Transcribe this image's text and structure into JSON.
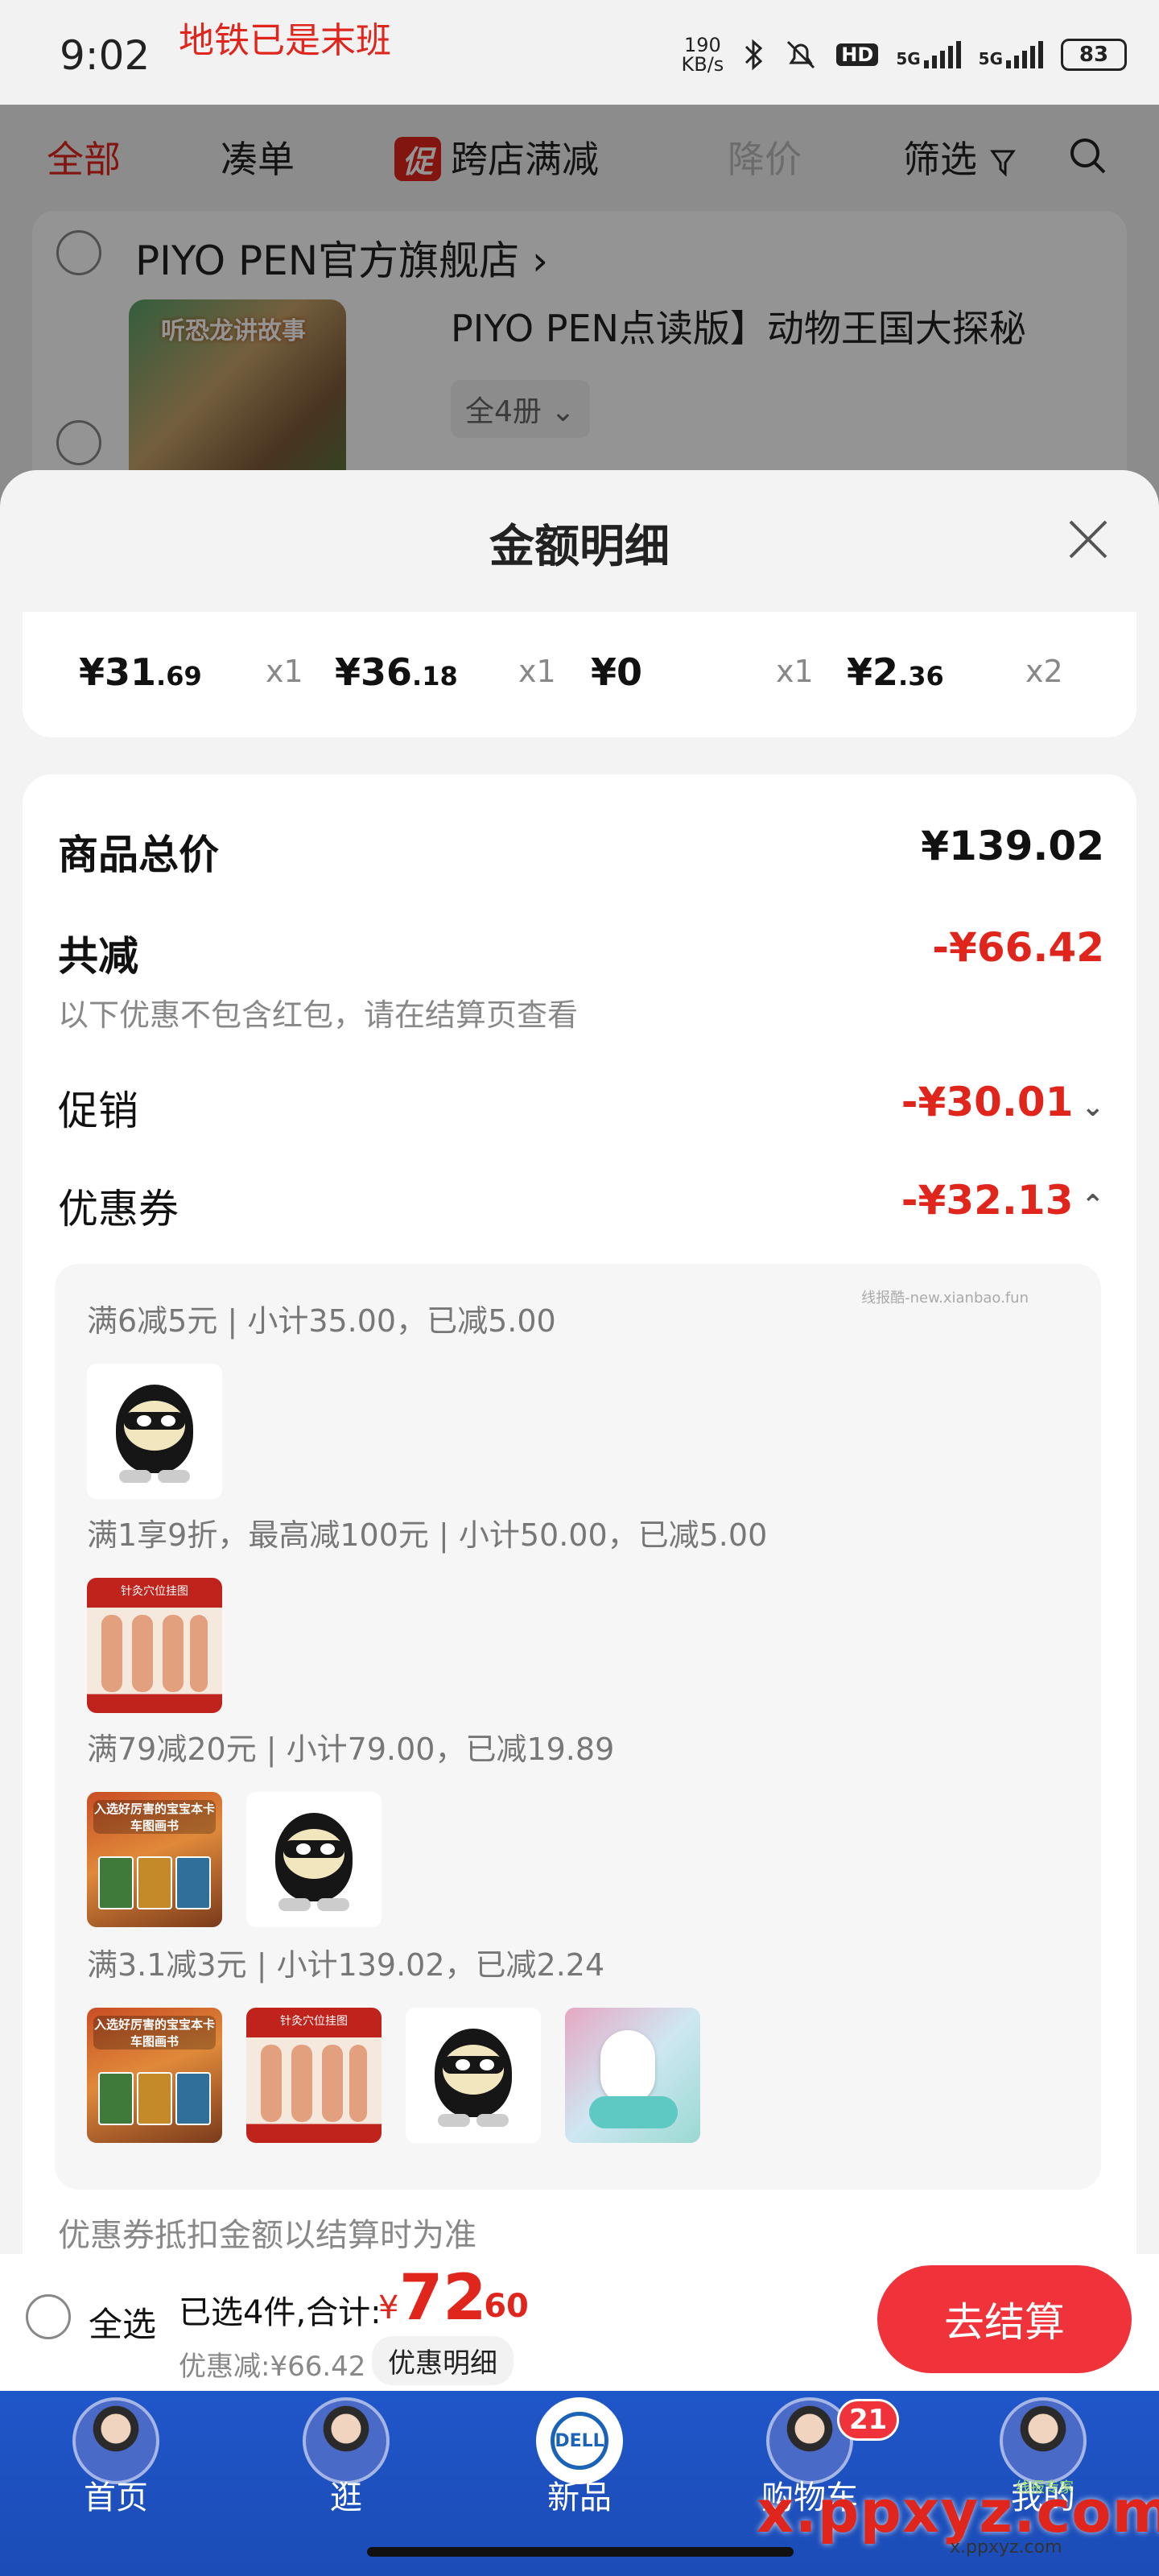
{
  "status_bar": {
    "time": "9:02",
    "overlay_text": "地铁已是末班",
    "net_speed_value": "190",
    "net_speed_unit": "KB/s",
    "hd_label": "HD",
    "signal_1": "5G",
    "signal_2": "5G",
    "battery": "83"
  },
  "filter_tabs": {
    "all": "全部",
    "bundle": "凑单",
    "promo_badge": "促",
    "cross_store": "跨店满减",
    "price_drop": "降价",
    "filter": "筛选"
  },
  "background_cart": {
    "shop_name": "PIYO PEN官方旗舰店",
    "product_title": "PIYO PEN点读版】动物王国大探秘",
    "product_thumb_title": "听恐龙讲故事",
    "variant": "全4册"
  },
  "sheet": {
    "title": "金额明细",
    "items": [
      {
        "currency": "¥",
        "int": "31",
        "dec": ".69",
        "qty": "x1"
      },
      {
        "currency": "¥",
        "int": "36",
        "dec": ".18",
        "qty": "x1"
      },
      {
        "currency": "¥",
        "int": "0",
        "dec": "",
        "qty": "x1"
      },
      {
        "currency": "¥",
        "int": "2",
        "dec": ".36",
        "qty": "x2"
      }
    ],
    "total_label": "商品总价",
    "total_value": "¥139.02",
    "discount_label": "共减",
    "discount_value": "-¥66.42",
    "discount_note": "以下优惠不包含红包，请在结算页查看",
    "promo_label": "促销",
    "promo_value": "-¥30.01",
    "coupon_label": "优惠券",
    "coupon_value": "-¥32.13",
    "watermark": "线报酷-new.xianbao.fun",
    "coupon_rules": [
      "满6减5元 | 小计35.00，已减5.00",
      "满1享9折，最高减100元 | 小计50.00，已减5.00",
      "满79减20元 | 小计79.00，已减19.89",
      "满3.1减3元 | 小计139.02，已减2.24"
    ],
    "thumb_texts": {
      "acupoint": "针灸穴位挂图",
      "picturebook": "入选好厉害的宝宝本卡车图画书"
    },
    "settle_note": "优惠券抵扣金额以结算时为准"
  },
  "checkout": {
    "select_all": "全选",
    "summary_label": "已选4件,合计:",
    "currency": "¥",
    "total_int": "72",
    "total_dec": ".60",
    "saved": "优惠减:¥66.42",
    "detail_chip": "优惠明细",
    "checkout_button": "去结算"
  },
  "bottom_nav": {
    "items": [
      {
        "label": "首页"
      },
      {
        "label": "逛"
      },
      {
        "label": "新品",
        "logo": "DELL"
      },
      {
        "label": "购物车",
        "badge": "21"
      },
      {
        "label": "我的"
      }
    ]
  },
  "site_watermark": {
    "main": "x.ppxyz.com",
    "small": "x.ppxyz.com",
    "tag": "线报专家"
  },
  "colors": {
    "accent_red": "#e0251c",
    "checkout_red": "#f0323a",
    "nav_blue": "#1f56c9"
  },
  "icons": [
    "bluetooth-icon",
    "mute-bell-icon",
    "signal-bars-icon",
    "battery-icon",
    "filter-funnel-icon",
    "search-icon",
    "close-icon",
    "chevron-down-icon",
    "chevron-up-icon",
    "radio-circle-icon"
  ]
}
